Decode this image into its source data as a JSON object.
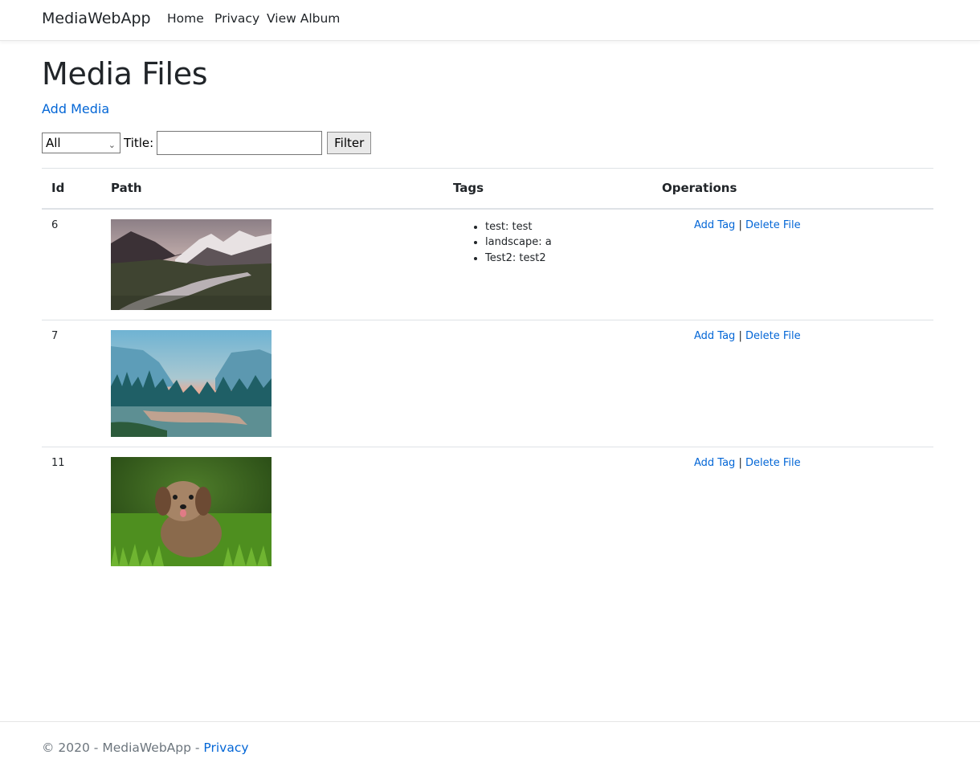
{
  "navbar": {
    "brand": "MediaWebApp",
    "links": [
      "Home",
      "Privacy",
      "View Album"
    ]
  },
  "page": {
    "title": "Media Files",
    "add_media_label": "Add Media"
  },
  "filter": {
    "type_selected": "All",
    "title_label": "Title:",
    "title_value": "",
    "button_label": "Filter"
  },
  "table": {
    "headers": [
      "Id",
      "Path",
      "Tags",
      "Operations"
    ],
    "rows": [
      {
        "id": "6",
        "image": "mountain-river-landscape",
        "tags": [
          "test: test",
          "landscape: a",
          "Test2: test2"
        ],
        "ops": [
          "Add Tag",
          "Delete File"
        ]
      },
      {
        "id": "7",
        "image": "forest-river-sunset",
        "tags": [],
        "ops": [
          "Add Tag",
          "Delete File"
        ]
      },
      {
        "id": "11",
        "image": "puppy-in-grass",
        "tags": [],
        "ops": [
          "Add Tag",
          "Delete File"
        ]
      }
    ],
    "op_separator": "|"
  },
  "footer": {
    "text": "© 2020 - MediaWebApp - ",
    "privacy_link": "Privacy"
  },
  "colors": {
    "link": "#0366d6",
    "text": "#212529",
    "muted": "#6c757d",
    "border": "#dee2e6"
  }
}
